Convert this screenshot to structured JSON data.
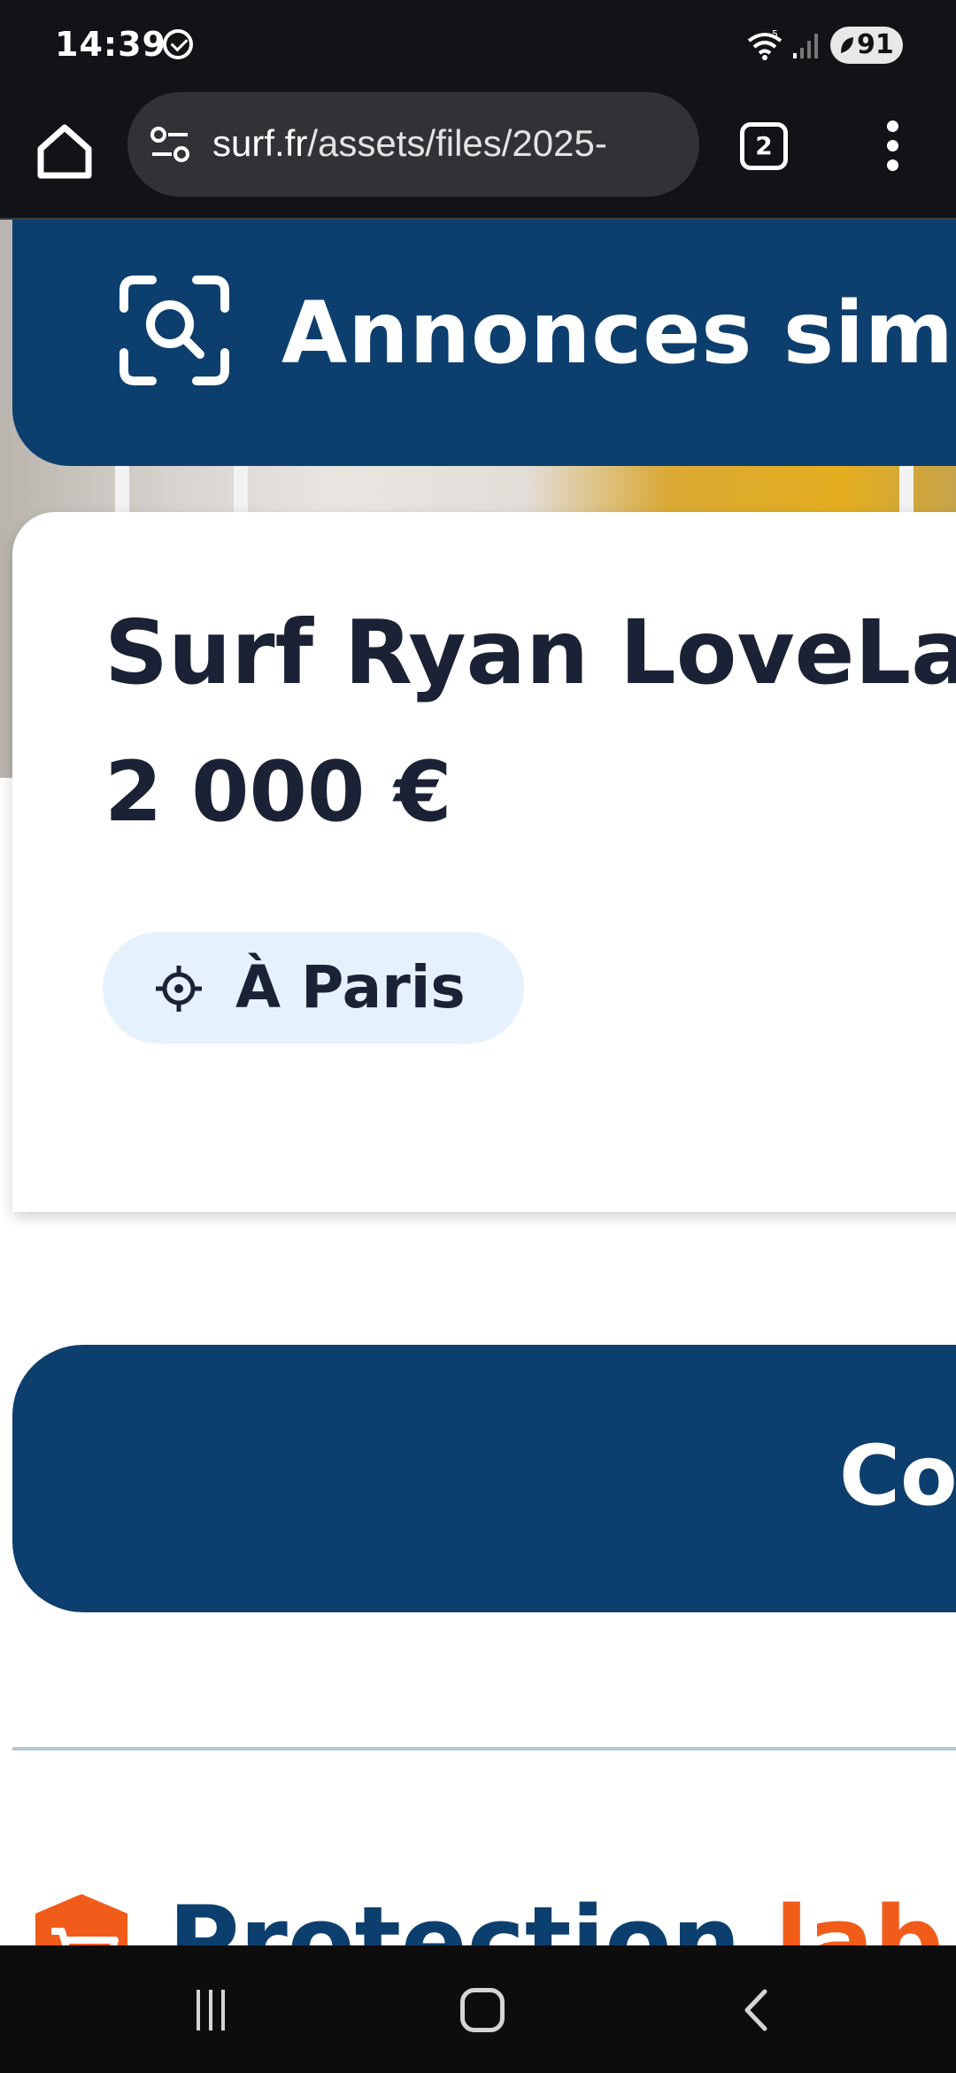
{
  "status_bar": {
    "time": "14:39",
    "battery": "91",
    "icons": [
      "notification-icon",
      "wifi-icon",
      "signal-icon",
      "battery-icon"
    ]
  },
  "browser": {
    "url_domain": "surf.fr",
    "url_path": "/assets/files/2025-",
    "tab_count": "2",
    "icons": [
      "home-icon",
      "site-settings-icon",
      "tabs-icon",
      "more-menu-icon"
    ]
  },
  "page": {
    "similar_banner": {
      "label": "Annonces simi",
      "icon": "scan-search-icon"
    },
    "listing": {
      "title": "Surf Ryan LoveLa",
      "price": "2 000 €",
      "location": "À Paris",
      "location_icon": "location-target-icon"
    },
    "contact_button": {
      "label": "Co"
    },
    "protection": {
      "title_part1": "Protection ",
      "title_part2": "lab",
      "icon": "shopping-cart-shield-icon"
    },
    "colors": {
      "primary": "#0c3f6e",
      "accent": "#f25c1a",
      "chip_bg": "#e5f1fd",
      "text_dark": "#1b2236"
    }
  },
  "nav_bar": {
    "icons": [
      "recent-apps-icon",
      "home-nav-icon",
      "back-icon"
    ]
  }
}
